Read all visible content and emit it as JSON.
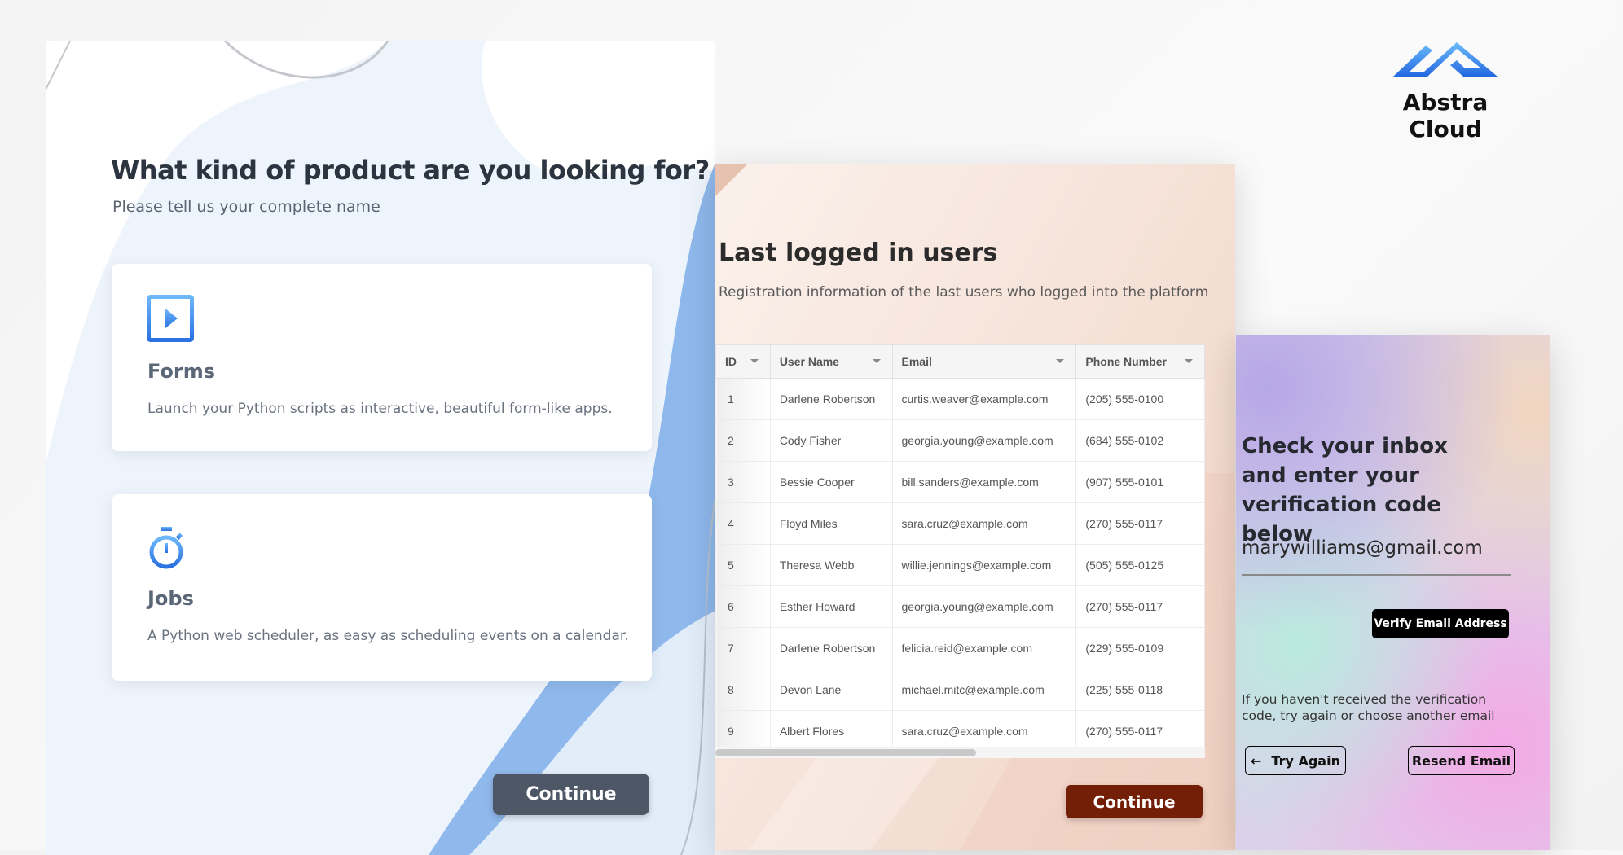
{
  "brand": {
    "name": "Abstra Cloud",
    "color": "#2f7fe8"
  },
  "forms_screen": {
    "title": "What kind of product are you looking for?",
    "subtitle": "Please tell us your complete name",
    "options": [
      {
        "icon": "play-square-icon",
        "name": "Forms",
        "description": "Launch your Python scripts as interactive, beautiful form-like apps."
      },
      {
        "icon": "stopwatch-icon",
        "name": "Jobs",
        "description": "A Python web scheduler, as easy as scheduling events on a calendar."
      }
    ],
    "continue_label": "Continue"
  },
  "users_screen": {
    "title": "Last logged in users",
    "subtitle": "Registration information of the last users who logged into the platform",
    "columns": [
      "ID",
      "User Name",
      "Email",
      "Phone Number"
    ],
    "rows": [
      [
        "1",
        "Darlene Robertson",
        "curtis.weaver@example.com",
        "(205) 555-0100"
      ],
      [
        "2",
        "Cody Fisher",
        "georgia.young@example.com",
        "(684) 555-0102"
      ],
      [
        "3",
        "Bessie Cooper",
        "bill.sanders@example.com",
        "(907) 555-0101"
      ],
      [
        "4",
        "Floyd Miles",
        "sara.cruz@example.com",
        "(270) 555-0117"
      ],
      [
        "5",
        "Theresa Webb",
        "willie.jennings@example.com",
        "(505) 555-0125"
      ],
      [
        "6",
        "Esther Howard",
        "georgia.young@example.com",
        "(270) 555-0117"
      ],
      [
        "7",
        "Darlene Robertson",
        "felicia.reid@example.com",
        "(229) 555-0109"
      ],
      [
        "8",
        "Devon Lane",
        "michael.mitc@example.com",
        "(225) 555-0118"
      ],
      [
        "9",
        "Albert Flores",
        "sara.cruz@example.com",
        "(270) 555-0117"
      ]
    ],
    "continue_label": "Continue",
    "accent": "#731e06"
  },
  "verify_screen": {
    "title": "Check your inbox and enter your verification code below",
    "email": "marywilliams@gmail.com",
    "verify_label": "Verify Email Address",
    "help": "If you haven't received the verification code, try again or choose another email",
    "try_again_label": "Try Again",
    "resend_label": "Resend Email"
  }
}
